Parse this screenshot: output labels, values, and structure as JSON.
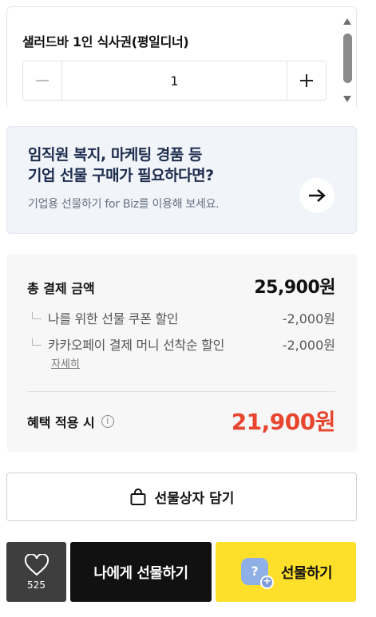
{
  "option": {
    "title": "샐러드바 1인 식사권(평일디너)",
    "quantity": "1"
  },
  "biz_banner": {
    "headline_line1": "임직원 복지, 마케팅 경품 등",
    "headline_line2": "기업 선물 구매가 필요하다면?",
    "subtext": "기업용 선물하기 for Biz를 이용해 보세요."
  },
  "payment": {
    "total_label": "총 결제 금액",
    "total_value": "25,900원",
    "discounts": [
      {
        "label": "나를 위한 선물 쿠폰 할인",
        "value": "-2,000원"
      },
      {
        "label": "카카오페이 결제 머니 선착순 할인",
        "value": "-2,000원"
      }
    ],
    "detail_link": "자세히",
    "benefit_label": "혜택 적용 시",
    "info_glyph": "i",
    "benefit_value": "21,900원"
  },
  "actions": {
    "giftbox_label": "선물상자 담기",
    "wish_count": "525",
    "self_gift_label": "나에게 선물하기",
    "gift_label": "선물하기",
    "gift_icon_glyph": "?",
    "gift_icon_plus": "+"
  },
  "colors": {
    "accent_yellow": "#fee02a",
    "benefit_red": "#e8452f",
    "banner_bg": "#f1f4f9"
  },
  "icons": [
    "minus-icon",
    "plus-icon",
    "arrow-right-icon",
    "info-icon",
    "shopping-bag-icon",
    "heart-icon",
    "gift-add-icon"
  ]
}
